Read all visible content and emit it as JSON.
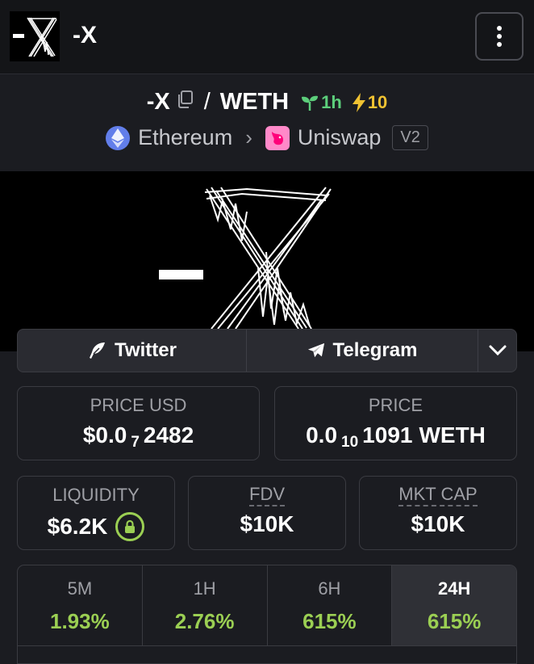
{
  "header": {
    "title": "-X",
    "logo_text": "-X",
    "menu_icon": "kebab-menu-icon"
  },
  "pair": {
    "base": "-X",
    "separator": "/",
    "quote": "WETH",
    "age": "1h",
    "boosts": "10",
    "chain": "Ethereum",
    "dex": "Uniswap",
    "version": "V2",
    "colors": {
      "age": "#5cce7b",
      "boost": "#f0c232"
    }
  },
  "banner": {
    "text": "-X"
  },
  "socials": {
    "twitter": "Twitter",
    "telegram": "Telegram"
  },
  "stats": {
    "price_usd": {
      "label": "PRICE USD",
      "prefix": "$0.0",
      "zeros": "7",
      "digits": "2482"
    },
    "price_native": {
      "label": "PRICE",
      "prefix": "0.0",
      "zeros": "10",
      "digits": "1091",
      "unit": "WETH"
    },
    "liquidity": {
      "label": "LIQUIDITY",
      "value": "$6.2K"
    },
    "fdv": {
      "label": "FDV",
      "value": "$10K"
    },
    "mkt_cap": {
      "label": "MKT CAP",
      "value": "$10K"
    }
  },
  "timeframes": [
    {
      "label": "5M",
      "change": "1.93%"
    },
    {
      "label": "1H",
      "change": "2.76%"
    },
    {
      "label": "6H",
      "change": "615%"
    },
    {
      "label": "24H",
      "change": "615%",
      "active": true
    }
  ],
  "colors": {
    "positive": "#9bcf53",
    "background": "#1b1c21"
  }
}
